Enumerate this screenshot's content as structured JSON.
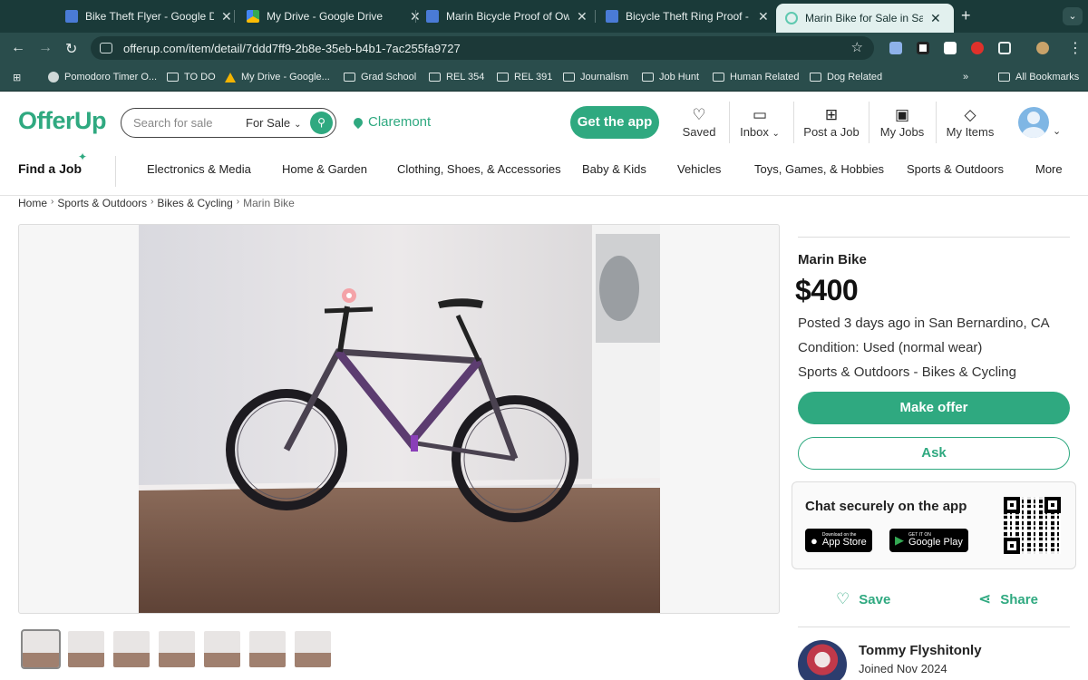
{
  "browser": {
    "tabs": [
      {
        "title": "Bike Theft Flyer - Google Drive",
        "icon": "google-docs-icon"
      },
      {
        "title": "My Drive - Google Drive",
        "icon": "google-drive-icon"
      },
      {
        "title": "Marin Bicycle Proof of Ownership",
        "icon": "google-docs-icon"
      },
      {
        "title": "Bicycle Theft Ring Proof - Google Docs",
        "icon": "google-docs-icon"
      },
      {
        "title": "Marin Bike for Sale in San Bernardino",
        "icon": "offerup-icon"
      }
    ],
    "url": "offerup.com/item/detail/7ddd7ff9-2b8e-35eb-b4b1-7ac255fa9727",
    "bookmarks": [
      "Pomodoro Timer O...",
      "TO DO",
      "My Drive - Google...",
      "Grad School",
      "REL 354",
      "REL 391",
      "Journalism",
      "Job Hunt",
      "Human Related",
      "Dog Related"
    ],
    "all_bookmarks": "All Bookmarks"
  },
  "header": {
    "logo": "OfferUp",
    "search_placeholder": "Search for sale",
    "search_scope": "For Sale",
    "location": "Claremont",
    "get_app": "Get the app",
    "nav": {
      "saved": "Saved",
      "inbox": "Inbox",
      "post_job": "Post a Job",
      "my_jobs": "My Jobs",
      "my_items": "My Items"
    }
  },
  "categories": {
    "find_job": "Find a Job",
    "items": [
      "Electronics & Media",
      "Home & Garden",
      "Clothing, Shoes, & Accessories",
      "Baby & Kids",
      "Vehicles",
      "Toys, Games, & Hobbies",
      "Sports & Outdoors",
      "More"
    ]
  },
  "breadcrumb": [
    "Home",
    "Sports & Outdoors",
    "Bikes & Cycling",
    "Marin Bike"
  ],
  "listing": {
    "title": "Marin Bike",
    "price": "$400",
    "posted": "Posted 3 days ago in San Bernardino, CA",
    "condition": "Condition: Used (normal wear)",
    "category": "Sports & Outdoors - Bikes & Cycling",
    "make_offer": "Make offer",
    "ask": "Ask",
    "chat_title": "Chat securely on the app",
    "app_store_small": "Download on the",
    "app_store": "App Store",
    "play_small": "GET IT ON",
    "play": "Google Play",
    "save": "Save",
    "share": "Share"
  },
  "seller": {
    "name": "Tommy Flyshitonly",
    "joined": "Joined Nov 2024"
  },
  "thumbnail_count": 7,
  "colors": {
    "brand": "#2fa980",
    "chrome_dark": "#1a3a39",
    "chrome": "#2a4d4c"
  }
}
